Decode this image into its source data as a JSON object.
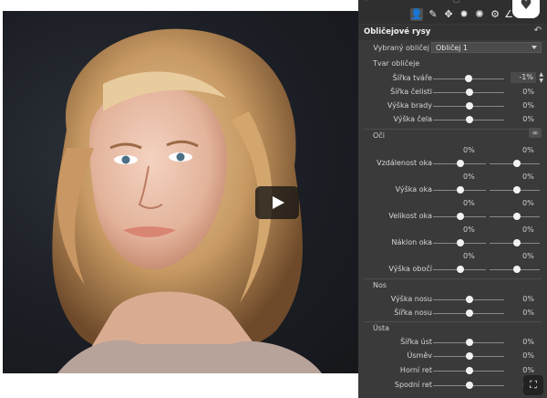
{
  "panel": {
    "section_title": "Obličejové rysy",
    "face_selector": {
      "label": "Vybraný obličej",
      "value": "Obličej 1"
    },
    "groups": {
      "face_shape": "Tvar obličeje",
      "eyes": "Oči",
      "nose": "Nos",
      "mouth": "Ústa"
    },
    "face_shape_sliders": [
      {
        "label": "Šířka tváře",
        "value": "-1%",
        "level": -1
      },
      {
        "label": "Šířka čelisti",
        "value": "0%",
        "level": 0
      },
      {
        "label": "Výška brady",
        "value": "0%",
        "level": 0
      },
      {
        "label": "Výška čela",
        "value": "0%",
        "level": 0
      }
    ],
    "eye_sliders": [
      {
        "label": "Vzdálenost oka",
        "left": "0%",
        "right": "0%"
      },
      {
        "label": "Výška oka",
        "left": "0%",
        "right": "0%"
      },
      {
        "label": "Velikost oka",
        "left": "0%",
        "right": "0%"
      },
      {
        "label": "Náklon oka",
        "left": "0%",
        "right": "0%"
      },
      {
        "label": "Výška obočí",
        "left": "0%",
        "right": "0%"
      }
    ],
    "nose_sliders": [
      {
        "label": "Výška nosu",
        "value": "0%",
        "level": 0
      },
      {
        "label": "Šířka nosu",
        "value": "0%",
        "level": 0
      }
    ],
    "mouth_sliders": [
      {
        "label": "Šířka úst",
        "value": "0%",
        "level": 0
      },
      {
        "label": "Úsměv",
        "value": "0%",
        "level": 0
      },
      {
        "label": "Horní ret",
        "value": "0%",
        "level": 0
      },
      {
        "label": "Spodní ret",
        "value": "0%",
        "level": 0
      }
    ]
  },
  "icons": {
    "toolbar": [
      "person-icon",
      "brush-icon",
      "move-icon",
      "sparkle-icon",
      "swirl-icon",
      "gear-icon",
      "pen-icon",
      "eye-dropper-icon"
    ],
    "heart": "heart-icon",
    "reset": "reset-icon",
    "link": "link-icon",
    "play": "play-icon",
    "expand": "expand-icon"
  },
  "colors": {
    "panel_bg": "#3a3a3a",
    "toolbar_bg": "#2f2f2f",
    "thumb": "#f2f2f2",
    "text": "#d6d6d6"
  }
}
